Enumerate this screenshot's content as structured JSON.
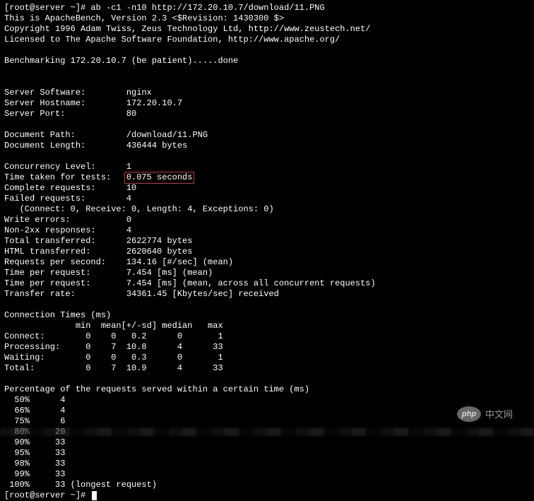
{
  "prompt1": "[root@server ~]# ab -c1 -n10 http://172.20.10.7/download/11.PNG",
  "header": {
    "l1": "This is ApacheBench, Version 2.3 <$Revision: 1430300 $>",
    "l2": "Copyright 1996 Adam Twiss, Zeus Technology Ltd, http://www.zeustech.net/",
    "l3": "Licensed to The Apache Software Foundation, http://www.apache.org/"
  },
  "benchmarking": "Benchmarking 172.20.10.7 (be patient).....done",
  "server_info": {
    "software": "Server Software:        nginx",
    "hostname": "Server Hostname:        172.20.10.7",
    "port": "Server Port:            80"
  },
  "document": {
    "path": "Document Path:          /download/11.PNG",
    "length": "Document Length:        436444 bytes"
  },
  "results": {
    "concurrency": "Concurrency Level:      1",
    "time_label": "Time taken for tests:   ",
    "time_value": "0.075 seconds",
    "complete": "Complete requests:      10",
    "failed": "Failed requests:        4",
    "failed_detail": "   (Connect: 0, Receive: 0, Length: 4, Exceptions: 0)",
    "write_errors": "Write errors:           0",
    "non2xx": "Non-2xx responses:      4",
    "total_trans": "Total transferred:      2622774 bytes",
    "html_trans": "HTML transferred:       2620640 bytes",
    "rps": "Requests per second:    134.16 [#/sec] (mean)",
    "tpr1": "Time per request:       7.454 [ms] (mean)",
    "tpr2": "Time per request:       7.454 [ms] (mean, across all concurrent requests)",
    "transfer": "Transfer rate:          34361.45 [Kbytes/sec] received"
  },
  "conn": {
    "title": "Connection Times (ms)",
    "head": "              min  mean[+/-sd] median   max",
    "connect": "Connect:        0    0   0.2      0       1",
    "process": "Processing:     0    7  10.8      4      33",
    "waiting": "Waiting:        0    0   0.3      0       1",
    "total": "Total:          0    7  10.9      4      33"
  },
  "perc": {
    "title": "Percentage of the requests served within a certain time (ms)",
    "p50": "  50%      4",
    "p66": "  66%      4",
    "p75": "  75%      6",
    "p80": "  80%     20",
    "p90": "  90%     33",
    "p95": "  95%     33",
    "p98": "  98%     33",
    "p99": "  99%     33",
    "p100": " 100%     33 (longest request)"
  },
  "prompt2": "[root@server ~]# ",
  "watermark": {
    "badge": "php",
    "text": "中文网"
  }
}
